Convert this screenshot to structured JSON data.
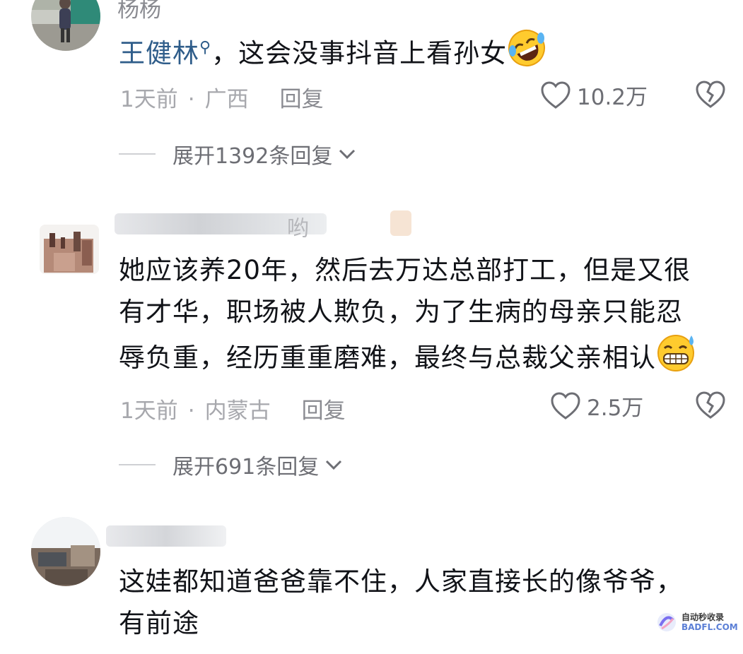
{
  "comments": [
    {
      "username": "杨杨",
      "mention": "王健林",
      "text_after_mention": "，这会没事抖音上看孙女",
      "emoji": "rofl-emoji",
      "time": "1天前",
      "location": "广西",
      "reply_label": "回复",
      "likes": "10.2万",
      "expand_label": "展开1392条回复"
    },
    {
      "username_fragment": "哟",
      "text_lines": [
        "她应该养20年，然后去万达总部打工，但是又很",
        "有才华，职场被人欺负，为了生病的母亲只能忍",
        "辱负重，经历重重磨难，最终与总裁父亲相认"
      ],
      "emoji": "grinning-sweat-emoji",
      "time": "1天前",
      "location": "内蒙古",
      "reply_label": "回复",
      "likes": "2.5万",
      "expand_label": "展开691条回复"
    },
    {
      "text_lines": [
        "这娃都知道爸爸靠不住，人家直接长的像爷爷，",
        "有前途"
      ]
    }
  ],
  "watermark": {
    "line1": "自动秒收录",
    "line2": "BADFL.COM"
  },
  "colors": {
    "mention": "#2f5d8a",
    "meta": "#a7a8ad",
    "text": "#111318"
  }
}
